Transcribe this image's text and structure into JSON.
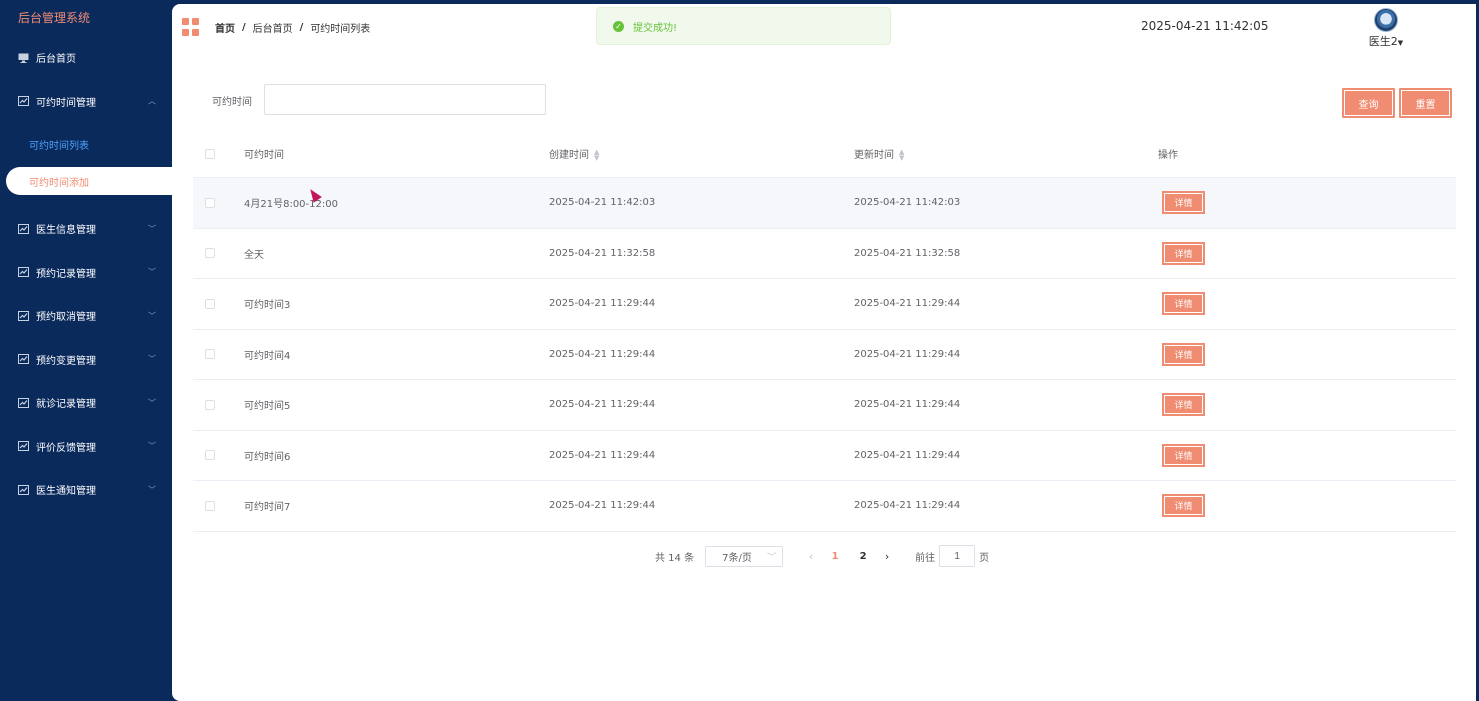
{
  "app": {
    "title": "后台管理系统"
  },
  "sidebar": {
    "items": [
      {
        "label": "后台首页",
        "icon": "monitor-icon"
      },
      {
        "label": "可约时间管理",
        "icon": "chart-icon",
        "expanded": true,
        "children": [
          {
            "label": "可约时间列表"
          },
          {
            "label": "可约时间添加"
          }
        ]
      },
      {
        "label": "医生信息管理",
        "icon": "chart-icon"
      },
      {
        "label": "预约记录管理",
        "icon": "chart-icon"
      },
      {
        "label": "预约取消管理",
        "icon": "chart-icon"
      },
      {
        "label": "预约变更管理",
        "icon": "chart-icon"
      },
      {
        "label": "就诊记录管理",
        "icon": "chart-icon"
      },
      {
        "label": "评价反馈管理",
        "icon": "chart-icon"
      },
      {
        "label": "医生通知管理",
        "icon": "chart-icon"
      }
    ]
  },
  "header": {
    "breadcrumb": [
      "首页",
      "后台首页",
      "可约时间列表"
    ],
    "toast": "提交成功!",
    "datetime": "2025-04-21 11:42:05",
    "user": "医生2"
  },
  "search": {
    "label": "可约时间",
    "value": "",
    "query_label": "查询",
    "reset_label": "重置"
  },
  "table": {
    "columns": [
      "可约时间",
      "创建时间",
      "更新时间",
      "操作"
    ],
    "detail_label": "详情",
    "rows": [
      {
        "time": "4月21号8:00-12:00",
        "created": "2025-04-21 11:42:03",
        "updated": "2025-04-21 11:42:03"
      },
      {
        "time": "全天",
        "created": "2025-04-21 11:32:58",
        "updated": "2025-04-21 11:32:58"
      },
      {
        "time": "可约时间3",
        "created": "2025-04-21 11:29:44",
        "updated": "2025-04-21 11:29:44"
      },
      {
        "time": "可约时间4",
        "created": "2025-04-21 11:29:44",
        "updated": "2025-04-21 11:29:44"
      },
      {
        "time": "可约时间5",
        "created": "2025-04-21 11:29:44",
        "updated": "2025-04-21 11:29:44"
      },
      {
        "time": "可约时间6",
        "created": "2025-04-21 11:29:44",
        "updated": "2025-04-21 11:29:44"
      },
      {
        "time": "可约时间7",
        "created": "2025-04-21 11:29:44",
        "updated": "2025-04-21 11:29:44"
      }
    ]
  },
  "pagination": {
    "total": "共 14 条",
    "page_size": "7条/页",
    "pages": [
      "1",
      "2"
    ],
    "current": "1",
    "goto_label": "前往",
    "goto_value": "1",
    "page_suffix": "页"
  },
  "colors": {
    "sidebar_bg": "#0b2a5c",
    "accent": "#f08c72",
    "link": "#4aa3ff",
    "success": "#67c23a"
  }
}
